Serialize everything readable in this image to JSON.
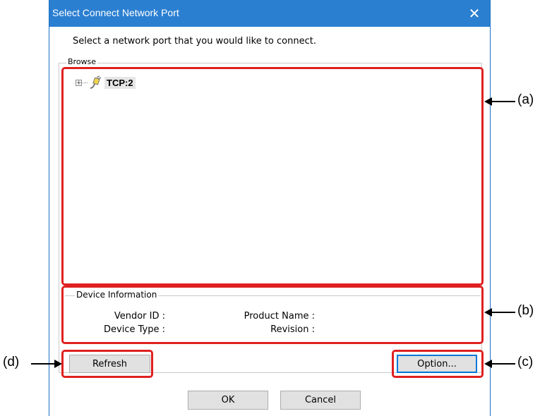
{
  "dialog": {
    "title": "Select Connect Network Port",
    "close_glyph": "✕",
    "prompt": "Select a network port that you would like to connect.",
    "browse_label": "Browse",
    "tree": {
      "expander_glyph": "+",
      "node_icon": "network-port-icon",
      "node_label": "TCP:2"
    },
    "device_info": {
      "label": "Device Information",
      "vendor_id_label": "Vendor ID :",
      "device_type_label": "Device Type :",
      "product_name_label": "Product Name :",
      "revision_label": "Revision :"
    },
    "buttons": {
      "refresh": "Refresh",
      "option": "Option...",
      "ok": "OK",
      "cancel": "Cancel"
    }
  },
  "annotations": {
    "a": "(a)",
    "b": "(b)",
    "c": "(c)",
    "d": "(d)",
    "callout_color": "#e02020"
  }
}
